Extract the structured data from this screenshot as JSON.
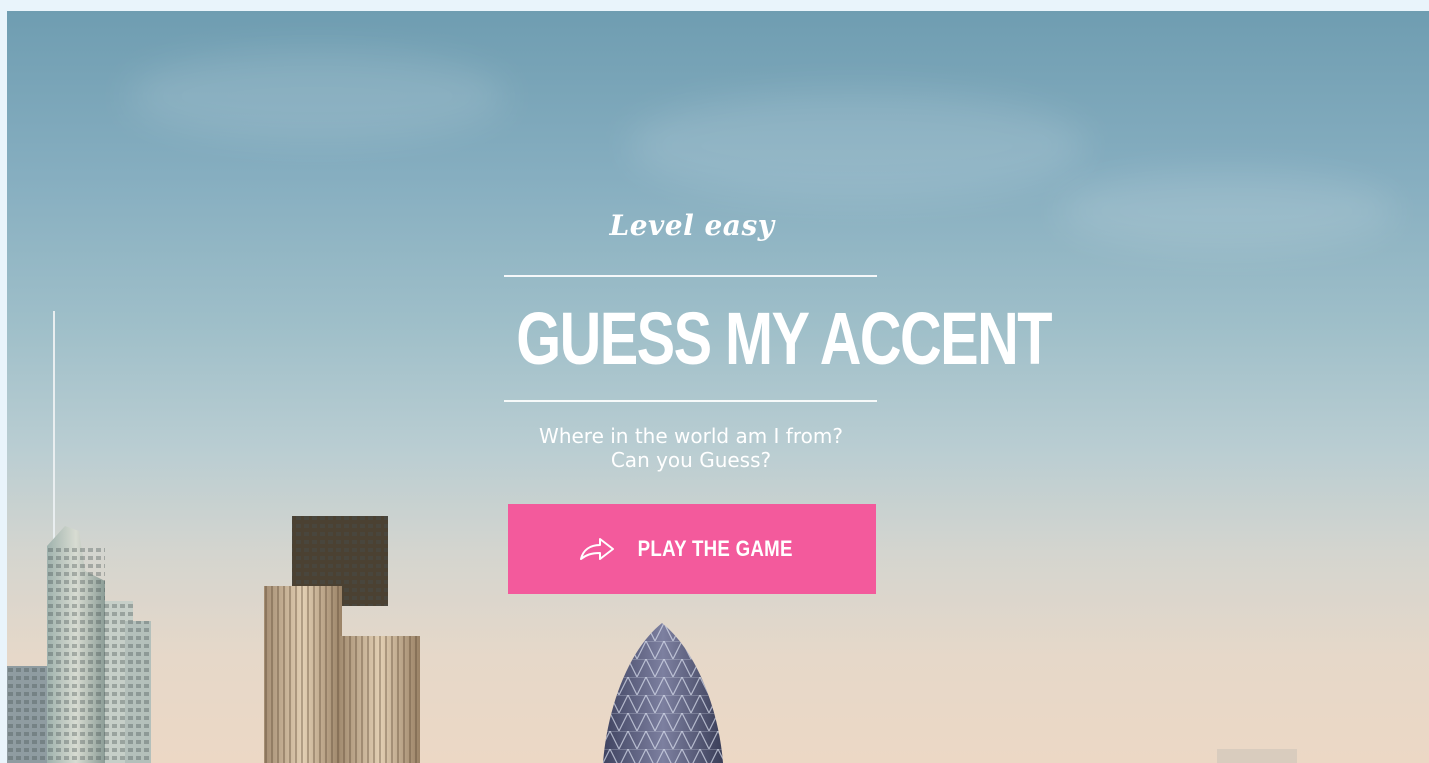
{
  "level": "Level easy",
  "title": "GUESS MY ACCENT",
  "subtitle": {
    "line1": "Where in the world am I from?",
    "line2": "Can you Guess?"
  },
  "play_button": {
    "label": "PLAY THE GAME",
    "icon": "share-arrow-icon",
    "color": "#f35a9c"
  },
  "colors": {
    "page_background": "#e9f4fb",
    "sky_top": "#6f9db1",
    "sky_bottom": "#ecd8c5",
    "text": "#ffffff"
  }
}
